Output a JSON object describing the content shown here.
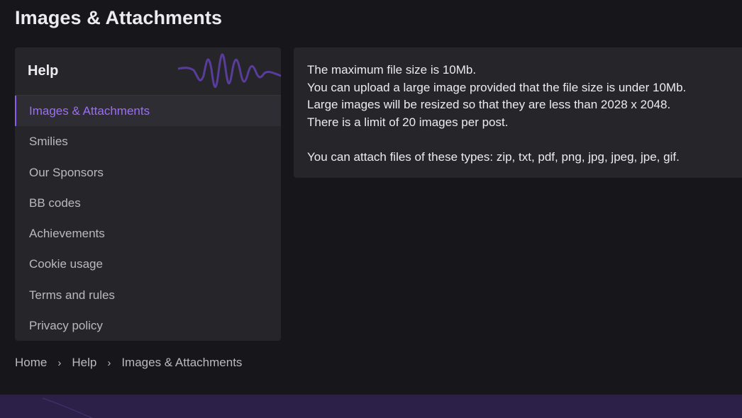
{
  "page": {
    "title": "Images & Attachments"
  },
  "sidebar": {
    "title": "Help",
    "items": [
      {
        "label": "Images & Attachments",
        "active": true
      },
      {
        "label": "Smilies"
      },
      {
        "label": "Our Sponsors"
      },
      {
        "label": "BB codes"
      },
      {
        "label": "Achievements"
      },
      {
        "label": "Cookie usage"
      },
      {
        "label": "Terms and rules"
      },
      {
        "label": "Privacy policy"
      }
    ]
  },
  "content": {
    "lines": [
      "The maximum file size is 10Mb.",
      "You can upload a large image provided that the file size is under 10Mb.",
      "Large images will be resized so that they are less than 2028 x 2048.",
      "There is a limit of 20 images per post.",
      "You can attach files of these types: zip, txt, pdf, png, jpg, jpeg, jpe, gif."
    ]
  },
  "breadcrumb": {
    "items": [
      "Home",
      "Help",
      "Images & Attachments"
    ],
    "separator": "›"
  },
  "colors": {
    "accent": "#8a5cf0",
    "background": "#17171b",
    "panel": "#25252a",
    "footer": "#2c1f48"
  }
}
